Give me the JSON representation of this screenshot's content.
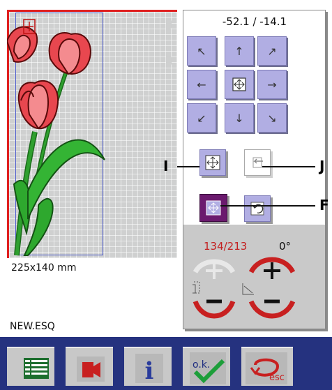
{
  "canvas": {
    "size_label": "225x140 mm",
    "file_name": "NEW.ESQ"
  },
  "panel": {
    "coordinates": "-52.1 / -14.1",
    "arrow_pad": [
      {
        "name": "move-up-left-button",
        "icon": "arrow-up-left-icon",
        "glyph": "↖"
      },
      {
        "name": "move-up-button",
        "icon": "arrow-up-icon",
        "glyph": "↑"
      },
      {
        "name": "move-up-right-button",
        "icon": "arrow-up-right-icon",
        "glyph": "↗"
      },
      {
        "name": "move-left-button",
        "icon": "arrow-left-icon",
        "glyph": "←"
      },
      {
        "name": "center-button",
        "icon": "center-icon",
        "glyph": ""
      },
      {
        "name": "move-right-button",
        "icon": "arrow-right-icon",
        "glyph": "→"
      },
      {
        "name": "move-down-left-button",
        "icon": "arrow-down-left-icon",
        "glyph": "↙"
      },
      {
        "name": "move-down-button",
        "icon": "arrow-down-icon",
        "glyph": "↓"
      },
      {
        "name": "move-down-right-button",
        "icon": "arrow-down-right-icon",
        "glyph": "↘"
      }
    ],
    "scale_value": "134/213",
    "rotate_value": "0°"
  },
  "callouts": {
    "i": "I",
    "j": "J",
    "f": "F"
  },
  "colors": {
    "accent_red": "#d42020",
    "button_lavender": "#b1aee3",
    "active_purple": "#6b1a6e",
    "bottom_bar": "#25327f"
  }
}
